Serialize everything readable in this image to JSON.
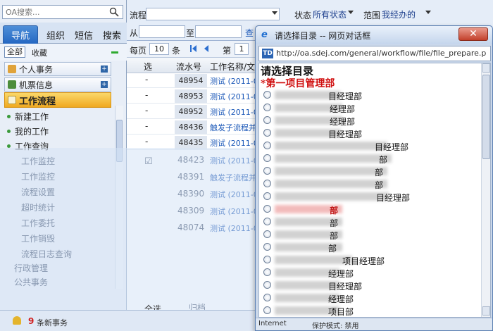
{
  "sidebar": {
    "search_placeholder": "OA搜索...",
    "tabs": [
      "导航",
      "组织",
      "短信",
      "搜索"
    ],
    "filter_all": "全部",
    "filter_fav": "收藏",
    "categories": [
      "个人事务",
      "机票信息",
      "工作流程"
    ],
    "workflow_items": [
      "新建工作",
      "我的工作",
      "工作查询"
    ],
    "ghost_items": [
      "工作监控",
      "工作监控",
      "流程设置",
      "超时统计",
      "工作委托",
      "工作销毁",
      "流程日志查询"
    ],
    "ghost_cats": [
      "行政管理",
      "公共事务"
    ]
  },
  "query": {
    "flow_label": "流程",
    "from_label": "从",
    "to_label": "至",
    "status_label": "状态",
    "status_value": "所有状态",
    "scope_label": "范围",
    "scope_value": "我经办的",
    "query_link": "查"
  },
  "pager": {
    "per_page_label": "每页",
    "per_page_value": "10",
    "items_label": "条",
    "page_label": "第",
    "page_value": "1"
  },
  "grid": {
    "headers": [
      "选",
      "流水号",
      "工作名称/文号"
    ],
    "rows": [
      {
        "select": "-",
        "id": "48954",
        "name": "测试 (2011-02-"
      },
      {
        "select": "-",
        "id": "48953",
        "name": "测试 (2011-02-"
      },
      {
        "select": "-",
        "id": "48952",
        "name": "测试 (2011-02-"
      },
      {
        "select": "-",
        "id": "48436",
        "name": "触发子流程并"
      },
      {
        "select": "-",
        "id": "48435",
        "name": "测试 (2011-01-"
      }
    ],
    "ghost_ids": [
      "48423",
      "48391",
      "48390",
      "48309",
      "48074"
    ],
    "ghost_names": [
      "测试 (2011-01-",
      "触发子流程并",
      "测试 (2011-01-",
      "测试 (2011-01-",
      "测试 (2011-01-"
    ],
    "select_all": "全选",
    "ghost_action": "归档"
  },
  "status_bar": {
    "badge": "9",
    "text": "条新事务"
  },
  "dialog": {
    "title": "请选择目录 -- 网页对话框",
    "ie_icon": "e",
    "close": "✕",
    "addr_icon": "TD",
    "url": "http://oa.sdej.com/general/workflow/file/file_prepare.p",
    "heading": "请选择目录",
    "sub_heading": "*第一项目管理部",
    "options": [
      "目经理部",
      "经理部",
      "经理部",
      "目经理部",
      "目经理部",
      "部",
      "部",
      "部",
      "目经理部",
      "部",
      "部",
      "部",
      "部",
      "项目经理部",
      "经理部",
      "目经理部",
      "经理部",
      "项目部"
    ],
    "status_left": "Internet",
    "status_right": "保护模式: 禁用"
  }
}
